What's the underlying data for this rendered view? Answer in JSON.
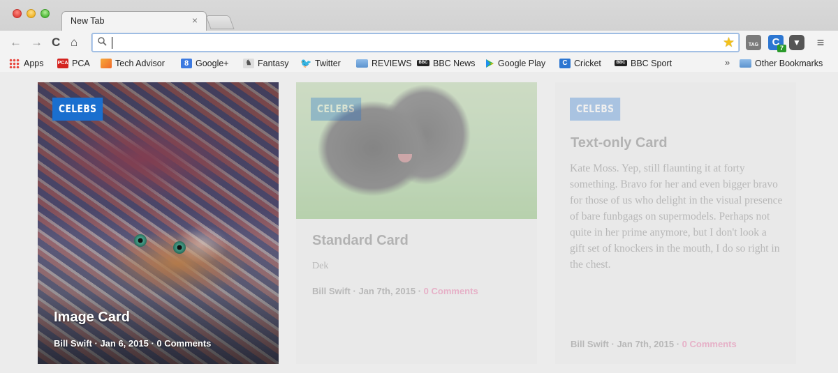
{
  "browser": {
    "tab_title": "New Tab",
    "tab_close": "×",
    "address_value": "",
    "extension_badge": "7",
    "bookmarks": [
      {
        "label": "Apps",
        "icon": "apps-grid-icon"
      },
      {
        "label": "PCA",
        "icon": "pca-icon"
      },
      {
        "label": "Tech Advisor",
        "icon": "tech-advisor-icon"
      },
      {
        "label": "Google+",
        "icon": "google-plus-icon"
      },
      {
        "label": "Fantasy",
        "icon": "fantasy-icon"
      },
      {
        "label": "Twitter",
        "icon": "twitter-bird-icon"
      },
      {
        "label": "REVIEWS",
        "icon": "folder-icon"
      },
      {
        "label": "BBC News",
        "icon": "bbc-icon"
      },
      {
        "label": "Google Play",
        "icon": "google-play-icon"
      },
      {
        "label": "Cricket",
        "icon": "c-icon"
      },
      {
        "label": "BBC Sport",
        "icon": "bbc-icon"
      }
    ],
    "more_bookmarks": "»",
    "other_bookmarks": "Other Bookmarks"
  },
  "cards": {
    "image": {
      "badge": "CELEBS",
      "title": "Image Card",
      "meta": "Bill Swift · Jan 6, 2015 · 0 Comments"
    },
    "standard": {
      "badge": "CELEBS",
      "title": "Standard Card",
      "dek": "Dek",
      "meta_author_date": "Bill Swift · Jan 7th, 2015 · ",
      "comments": "0 Comments"
    },
    "text": {
      "badge": "CELEBS",
      "title": "Text-only Card",
      "body": "Kate Moss. Yep, still flaunting it at forty something. Bravo for her and even bigger bravo for those of us who delight in the visual presence of bare funbgags on supermodels. Perhaps not quite in her prime anymore, but I don't look a gift set of knockers in the mouth, I do so right in the chest.",
      "meta_author_date": "Bill Swift · Jan 7th, 2015 · ",
      "comments": "0 Comments"
    }
  },
  "colors": {
    "badge_blue": "#1a6fcf",
    "comments_pink": "#e0196e"
  }
}
